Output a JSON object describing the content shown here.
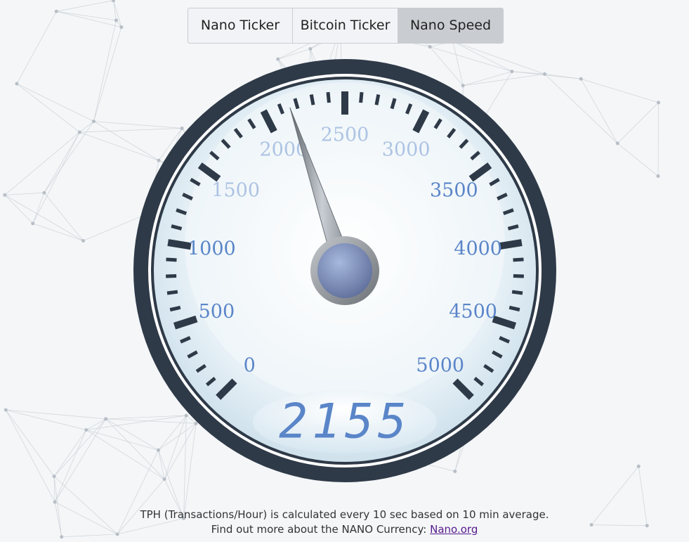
{
  "tabs": [
    {
      "label": "Nano Ticker"
    },
    {
      "label": "Bitcoin Ticker"
    },
    {
      "label": "Nano Speed",
      "active": true
    }
  ],
  "gauge": {
    "min": 0,
    "max": 5000,
    "value": 2155,
    "display": "2155",
    "major_labels": [
      "0",
      "500",
      "1000",
      "1500",
      "2000",
      "2500",
      "3000",
      "3500",
      "4000",
      "4500",
      "5000"
    ],
    "colors": {
      "bezel": "#2f3a48",
      "face": "#e3eef5",
      "labels": "#5a85c8",
      "digits": "#5a85c8",
      "needle": "#9aa0a6",
      "hub": "#7f93c4"
    }
  },
  "footer": {
    "line1": "TPH (Transactions/Hour) is calculated every 10 sec based on 10 min average.",
    "line2_prefix": "Find out more about the NANO Currency: ",
    "link_text": "Nano.org"
  }
}
